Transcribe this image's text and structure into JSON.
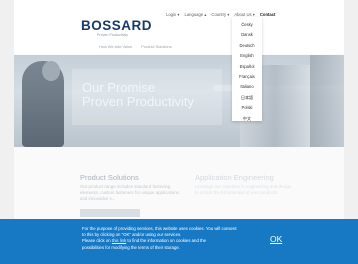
{
  "header": {
    "logo": {
      "wordmark": "BOSSARD",
      "tagline": "Proven Productivity"
    },
    "topnav": {
      "login": "Login ▾",
      "language": "Language ▴",
      "country": "Country ▾",
      "about": "About Us ▾",
      "contact": "Contact"
    },
    "mainnav": {
      "item1": "How We Add Value",
      "item2": "Product Solutions"
    }
  },
  "language_menu": [
    "Česky",
    "Dansk",
    "Deutsch",
    "English",
    "Español",
    "Français",
    "Italiano",
    "日本語",
    "Polski",
    "中文"
  ],
  "hero": {
    "line1": "Our Promise",
    "line2": "Proven Productivity"
  },
  "content": {
    "product_solutions": {
      "title": "Product Solutions",
      "body": "Our product range includes standard fastening elements, custom fasteners for unique applications and innovative s..."
    },
    "application_engineering": {
      "title": "Application Engineering",
      "body": "Leverage our expertise in engineering and design to unlock the full potential of your products"
    }
  },
  "cookie": {
    "line1": "For the purpose of providing services, this website uses cookies. You will consent",
    "line2": "to this by clicking on \"OK\" and/or using our services.",
    "line3_pre": "Please click on",
    "link": "this link",
    "line3_post": "to find the information on cookies and the",
    "line4": "possibilities for modifying the terms of their storage.",
    "ok": "OK"
  },
  "colors": {
    "brand_blue": "#183a6b",
    "cookie_bg": "#1779c4"
  }
}
